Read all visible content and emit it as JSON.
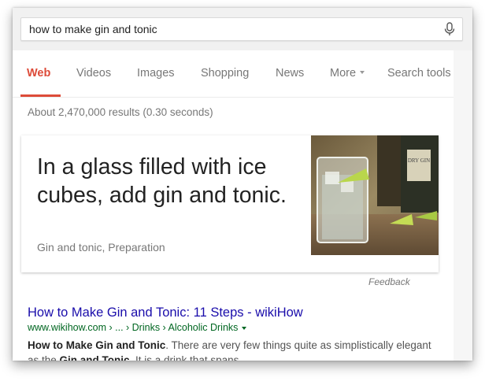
{
  "search": {
    "query": "how to make gin and tonic"
  },
  "tabs": [
    {
      "label": "Web",
      "active": true
    },
    {
      "label": "Videos"
    },
    {
      "label": "Images"
    },
    {
      "label": "Shopping"
    },
    {
      "label": "News"
    },
    {
      "label": "More"
    },
    {
      "label": "Search tools"
    }
  ],
  "stats": "About 2,470,000 results (0.30 seconds)",
  "answer_card": {
    "answer": "In a glass filled with ice cubes, add gin and tonic.",
    "source": "Gin and tonic, Preparation",
    "image_label": "DRY GIN"
  },
  "feedback_label": "Feedback",
  "result": {
    "title": "How to Make Gin and Tonic: 11 Steps - wikiHow",
    "url": "www.wikihow.com › ... › Drinks › Alcoholic Drinks",
    "snippet_bold_1": "How to Make Gin and Tonic",
    "snippet_text_1": ". There are very few things quite as simplistically elegant as the ",
    "snippet_bold_2": "Gin and Tonic",
    "snippet_text_2": ". It is a drink that spans"
  },
  "colors": {
    "accent": "#dd4b39",
    "link": "#1a0dab",
    "url": "#006621"
  }
}
